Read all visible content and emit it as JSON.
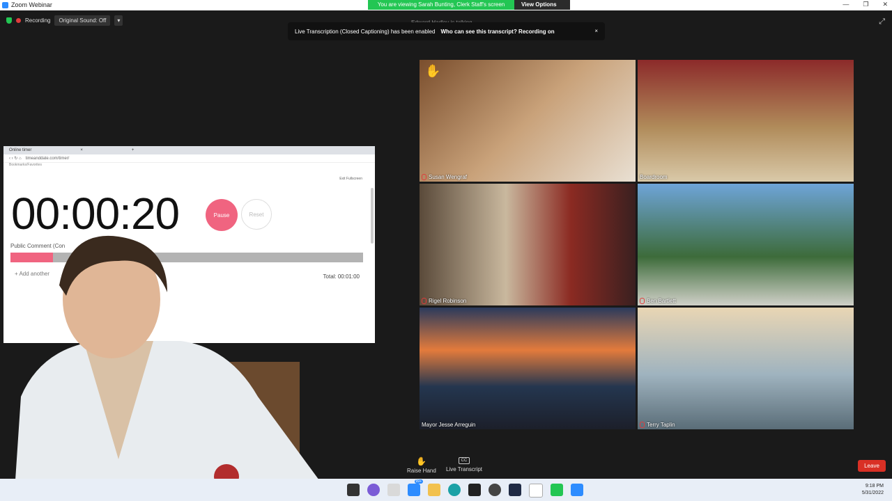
{
  "window": {
    "title": "Zoom Webinar"
  },
  "share_banner": {
    "viewing": "You are viewing Sarah Bunting, Clerk Staff's screen",
    "options": "View Options"
  },
  "window_controls": {
    "minimize": "—",
    "restore": "❐",
    "close": "✕"
  },
  "status": {
    "recording": "Recording",
    "sound": "Original Sound: Off",
    "caret": "▾",
    "talking": "Edward Hadley is talking..."
  },
  "transcript_notice": {
    "text": "Live Transcription (Closed Captioning) has been enabled",
    "question": "Who can see this transcript? Recording on",
    "close": "×"
  },
  "expand": "⤢",
  "browser": {
    "tab_title": "Online timer",
    "tab_close": "×",
    "new_tab": "+",
    "url": "timeanddate.com/timer/",
    "bookmarks": "Bookmarks/Favorites",
    "exit_fullscreen": "Exit Fullscreen",
    "timer": "00:00:20",
    "pause": "Pause",
    "reset": "Reset",
    "public_comment": "Public Comment (Con",
    "progress": 0.12,
    "add_another": "+ Add another",
    "total": "Total: 00:01:00"
  },
  "participants": [
    {
      "name": "Susan Wengraf",
      "muted": true,
      "hand": true
    },
    {
      "name": "Boardroom",
      "muted": false,
      "hand": false
    },
    {
      "name": "Rigel Robinson",
      "muted": true,
      "hand": false
    },
    {
      "name": "Ben Bartlett",
      "muted": true,
      "hand": false
    },
    {
      "name": "Mayor Jesse Arreguin",
      "muted": false,
      "hand": false
    },
    {
      "name": "Terry Taplin",
      "muted": true,
      "hand": false
    }
  ],
  "controls": {
    "raise_hand": "Raise Hand",
    "raise_hand_icon": "✋",
    "live_transcript": "Live Transcript",
    "cc": "CC",
    "leave": "Leave"
  },
  "taskbar": {
    "time": "9:18 PM",
    "date": "5/31/2022",
    "mail_badge": "99+"
  },
  "colors": {
    "accent_green": "#23c653",
    "leave_red": "#d93025",
    "timer_pink": "#f06480"
  }
}
